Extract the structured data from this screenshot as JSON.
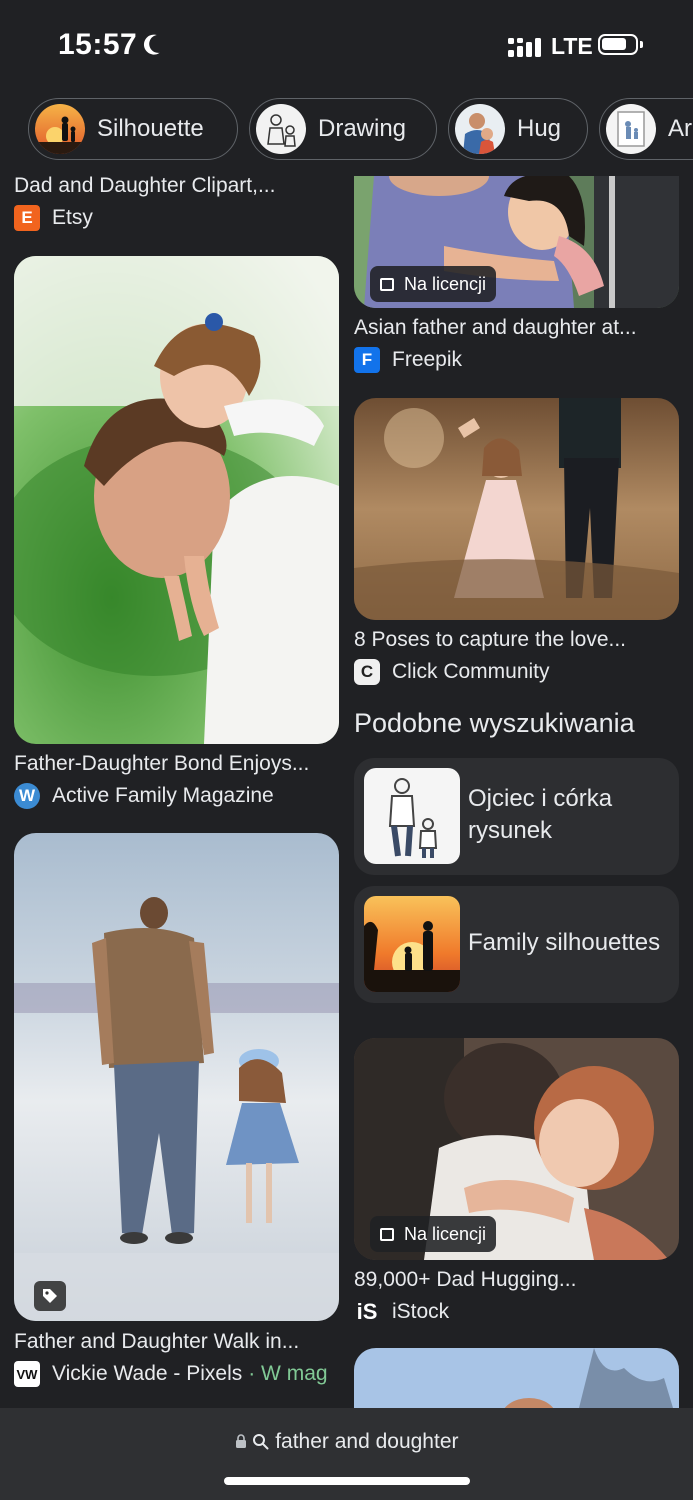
{
  "status_bar": {
    "time": "15:57",
    "network": "LTE"
  },
  "chips": [
    {
      "label": "Silhouette"
    },
    {
      "label": "Drawing"
    },
    {
      "label": "Hug"
    },
    {
      "label": "Ar"
    }
  ],
  "left_column": {
    "card1": {
      "caption": "Dad and Daughter Clipart,...",
      "source": "Etsy",
      "favicon": "E"
    },
    "card2": {
      "caption": "Father-Daughter Bond Enjoys...",
      "source": "Active Family Magazine",
      "favicon": "W"
    },
    "card3": {
      "caption": "Father and Daughter Walk in...",
      "source": "Vickie Wade - Pixels",
      "source_extra": "· W mag",
      "favicon": "VW"
    }
  },
  "right_column": {
    "card1": {
      "badge": "Na licencji",
      "caption": "Asian father and daughter at...",
      "source": "Freepik",
      "favicon": "F"
    },
    "card2": {
      "caption": "8 Poses to capture the love...",
      "source": "Click Community",
      "favicon": "C"
    },
    "related_heading": "Podobne wyszukiwania",
    "related": [
      {
        "line1": "Ojciec i córka",
        "line2": "rysunek"
      },
      {
        "line1": "Family silhouettes"
      }
    ],
    "card3": {
      "badge": "Na licencji",
      "caption": "89,000+ Dad Hugging...",
      "source": "iStock",
      "favicon": "iS"
    }
  },
  "address_bar": {
    "url": "father and doughter"
  },
  "colors": {
    "background": "#202124",
    "chip_border": "#5f6368",
    "etsy": "#f1641e",
    "freepik": "#1273eb",
    "wordpress": "#3b8bd3",
    "green_link": "#81c995"
  }
}
